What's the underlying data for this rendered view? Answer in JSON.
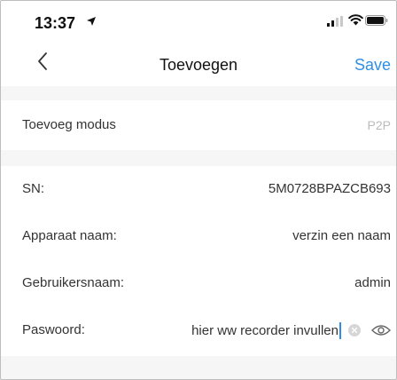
{
  "status_bar": {
    "time": "13:37"
  },
  "header": {
    "title": "Toevoegen",
    "save_label": "Save"
  },
  "mode_section": {
    "label": "Toevoeg modus",
    "value": "P2P"
  },
  "fields": {
    "sn": {
      "label": "SN:",
      "value": "5M0728BPAZCB693"
    },
    "device_name": {
      "label": "Apparaat naam:",
      "value": "verzin een naam"
    },
    "username": {
      "label": "Gebruikersnaam:",
      "value": "admin"
    },
    "password": {
      "label": "Paswoord:",
      "value": "hier ww recorder invullen"
    }
  },
  "colors": {
    "accent": "#2f8fe6",
    "background": "#f6f6f6"
  }
}
